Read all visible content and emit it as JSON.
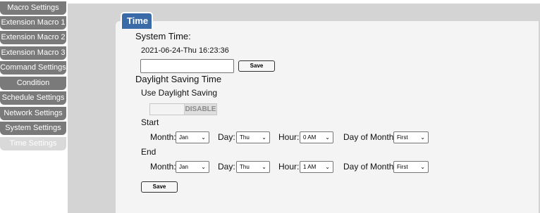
{
  "sidebar": {
    "items": [
      {
        "label": "Macro Settings"
      },
      {
        "label": "Extension Macro 1"
      },
      {
        "label": "Extension Macro 2"
      },
      {
        "label": "Extension Macro 3"
      },
      {
        "label": "Command Settings"
      },
      {
        "label": "Condition"
      },
      {
        "label": "Schedule Settings"
      },
      {
        "label": "Network Settings"
      },
      {
        "label": "System Settings"
      },
      {
        "label": "Time Settings",
        "active": true
      }
    ]
  },
  "panel": {
    "tab_title": "Time",
    "system_time_label": "System Time:",
    "system_time_value": "2021-06-24-Thu 16:23:36",
    "time_input_value": "",
    "save_label": "Save",
    "dst_heading": "Daylight Saving Time",
    "use_dst_label": "Use Daylight Saving",
    "dst_toggle_label": "DISABLE",
    "start": {
      "heading": "Start",
      "month_label": "Month:",
      "month_value": "Jan",
      "day_label": "Day:",
      "day_value": "Thu",
      "hour_label": "Hour:",
      "hour_value": "0 AM",
      "dom_label": "Day of Month:",
      "dom_value": "First"
    },
    "end": {
      "heading": "End",
      "month_label": "Month:",
      "month_value": "Jan",
      "day_label": "Day:",
      "day_value": "Thu",
      "hour_label": "Hour:",
      "hour_value": "1 AM",
      "dom_label": "Day of Month:",
      "dom_value": "First"
    },
    "bottom_save_label": "Save"
  },
  "icons": {
    "select_chevron": "chevron-down-icon"
  },
  "colors": {
    "sidebar_bg": "#7a7a7a",
    "sidebar_active": "#d9d9d9",
    "tab_bg": "#3a6aa8",
    "page_bg": "#d4d4d4",
    "panel_bg": "#f4f4f4"
  }
}
